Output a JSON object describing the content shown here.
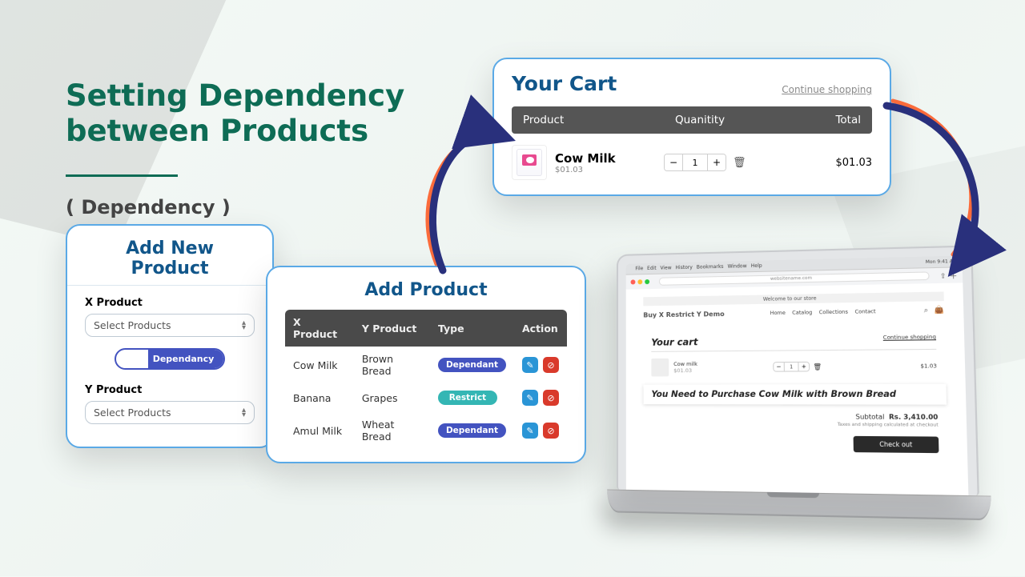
{
  "heading": {
    "line1": "Setting Dependency",
    "line2": "between Products",
    "subtitle": "( Dependency )"
  },
  "addNew": {
    "title": "Add New Product",
    "xLabel": "X Product",
    "yLabel": "Y Product",
    "selectPlaceholder": "Select Products",
    "toggleLabel": "Dependancy"
  },
  "addProduct": {
    "title": "Add Product",
    "columns": [
      "X Product",
      "Y Product",
      "Type",
      "Action"
    ],
    "rows": [
      {
        "x": "Cow Milk",
        "y": "Brown Bread",
        "type": "Dependant",
        "badgeClass": "dep"
      },
      {
        "x": "Banana",
        "y": "Grapes",
        "type": "Restrict",
        "badgeClass": "res"
      },
      {
        "x": "Amul Milk",
        "y": "Wheat Bread",
        "type": "Dependant",
        "badgeClass": "dep"
      }
    ]
  },
  "cart": {
    "title": "Your Cart",
    "continue": "Continue shopping",
    "cols": [
      "Product",
      "Quanitity",
      "Total"
    ],
    "item": {
      "name": "Cow Milk",
      "price": "$01.03",
      "qty": "1",
      "total": "$01.03"
    }
  },
  "laptop": {
    "menus": [
      "File",
      "Edit",
      "View",
      "History",
      "Bookmarks",
      "Window",
      "Help"
    ],
    "clock": "Mon 9:41 AM",
    "url": "websitename.com",
    "banner": "Welcome to our store",
    "brand": "Buy X Restrict Y Demo",
    "links": [
      "Home",
      "Catalog",
      "Collections",
      "Contact"
    ],
    "yourCart": "Your cart",
    "continue": "Continue shopping",
    "item": {
      "name": "Cow milk",
      "price": "$01.03",
      "qty": "1",
      "total": "$1.03"
    },
    "alert": "You Need to Purchase Cow Milk with Brown Bread",
    "subtotalLabel": "Subtotal",
    "subtotalAmount": "Rs. 3,410.00",
    "taxNote": "Taxes and shipping calculated at checkout",
    "checkout": "Check out"
  }
}
